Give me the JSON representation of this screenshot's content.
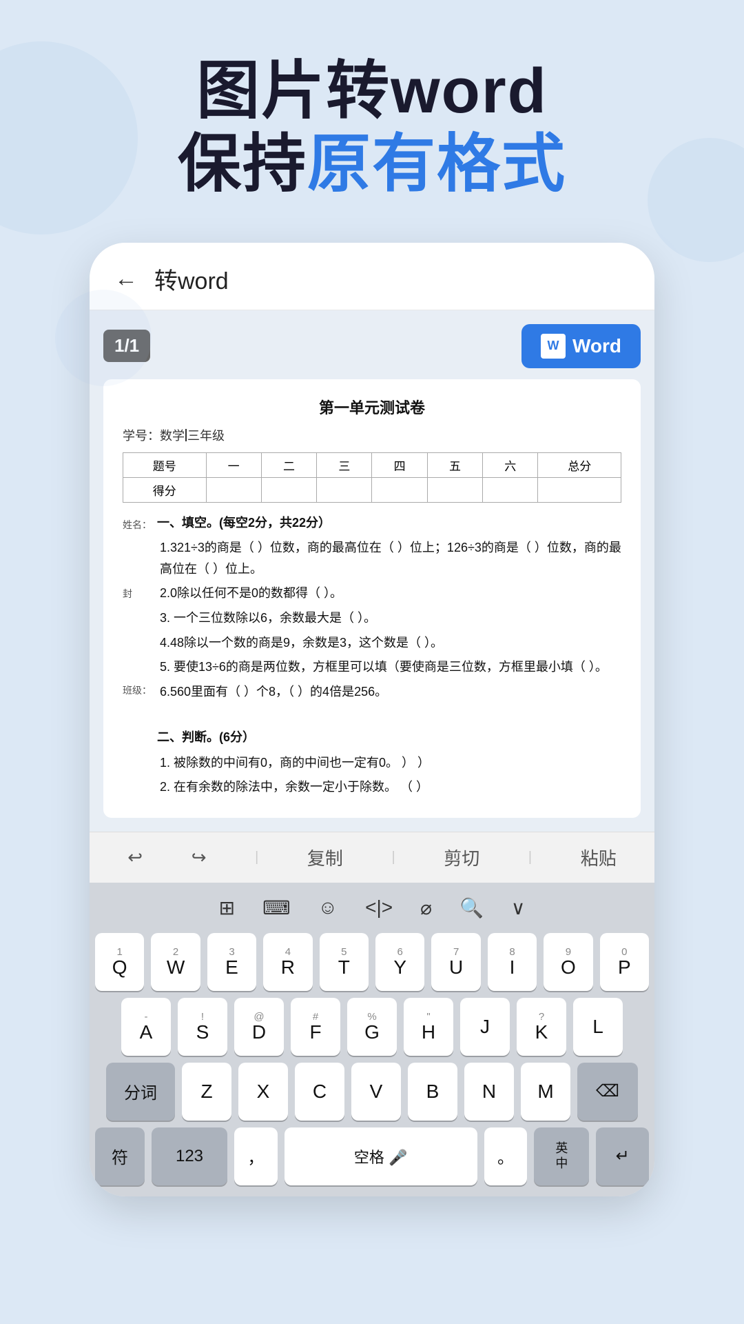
{
  "hero": {
    "line1": "图片转word",
    "line2_prefix": "保持",
    "line2_blue": "原有格式",
    "line2_suffix": ""
  },
  "phone": {
    "topbar": {
      "back_label": "←",
      "title": "转word"
    },
    "page_badge": "1/1",
    "word_button_label": "Word",
    "doc": {
      "title": "第一单元测试卷",
      "meta_label": "学号：",
      "meta_value_prefix": "数学",
      "meta_value_suffix": "三年级",
      "table_headers": [
        "题号",
        "一",
        "二",
        "三",
        "四",
        "五",
        "六",
        "总分"
      ],
      "table_row": [
        "得分",
        "",
        "",
        "",
        "",
        "",
        "",
        ""
      ],
      "side_labels": [
        "姓名：",
        "封",
        "班级："
      ],
      "sections": [
        {
          "title": "一、填空。(每空2分，共22分）",
          "questions": [
            "1.321÷3的商是（  ）位数，商的最高位在（  ）位上；126÷3的商是（  ）位数，商的最高位在（  ）位上。",
            "2.0除以任何不是0的数都得（  ）。",
            "3. 一个三位数除以6，余数最大是（  ）。",
            "4.48除以一个数的商是9，余数是3，这个数是（  ）。",
            "5. 要使13÷6的商是两位数，方框里可以填（要使商是三位数，方框里最小填（  ）。",
            "6.560里面有（  ）个8，（  ）的4倍是256。"
          ]
        },
        {
          "title": "二、判断。(6分）",
          "questions": [
            "1. 被除数的中间有0，商的中间也一定有0。    ）              ）",
            "2. 在有余数的除法中，余数一定小于除数。  （  ）"
          ]
        }
      ]
    },
    "toolbar": {
      "undo": "↩",
      "redo": "↪",
      "copy": "复制",
      "cut": "剪切",
      "paste": "粘贴"
    },
    "keyboard": {
      "func_row": [
        "⊞",
        "⌨",
        "☺",
        "</>",
        "⌀",
        "🔍",
        "∨"
      ],
      "row1_nums": [
        "1",
        "2",
        "3",
        "4",
        "5",
        "6",
        "7",
        "8",
        "9",
        "0"
      ],
      "row1_letters": [
        "Q",
        "W",
        "E",
        "R",
        "T",
        "Y",
        "U",
        "I",
        "O",
        "P"
      ],
      "row2_letters": [
        "A",
        "S",
        "D",
        "F",
        "G",
        "H",
        "J",
        "K",
        "L"
      ],
      "row2_nums": [
        "-",
        "!",
        "@",
        "#",
        "%",
        "\"",
        "",
        "?"
      ],
      "row3_letters": [
        "Z",
        "X",
        "C",
        "V",
        "B",
        "N",
        "M"
      ],
      "special_left": "分词",
      "special_sym": "符",
      "key_123": "123",
      "key_comma": "，",
      "key_space": "空格",
      "key_mic": "🎤",
      "key_dot": "。",
      "key_en": "英\n中",
      "key_enter": "↵",
      "key_delete": "⌫"
    }
  }
}
